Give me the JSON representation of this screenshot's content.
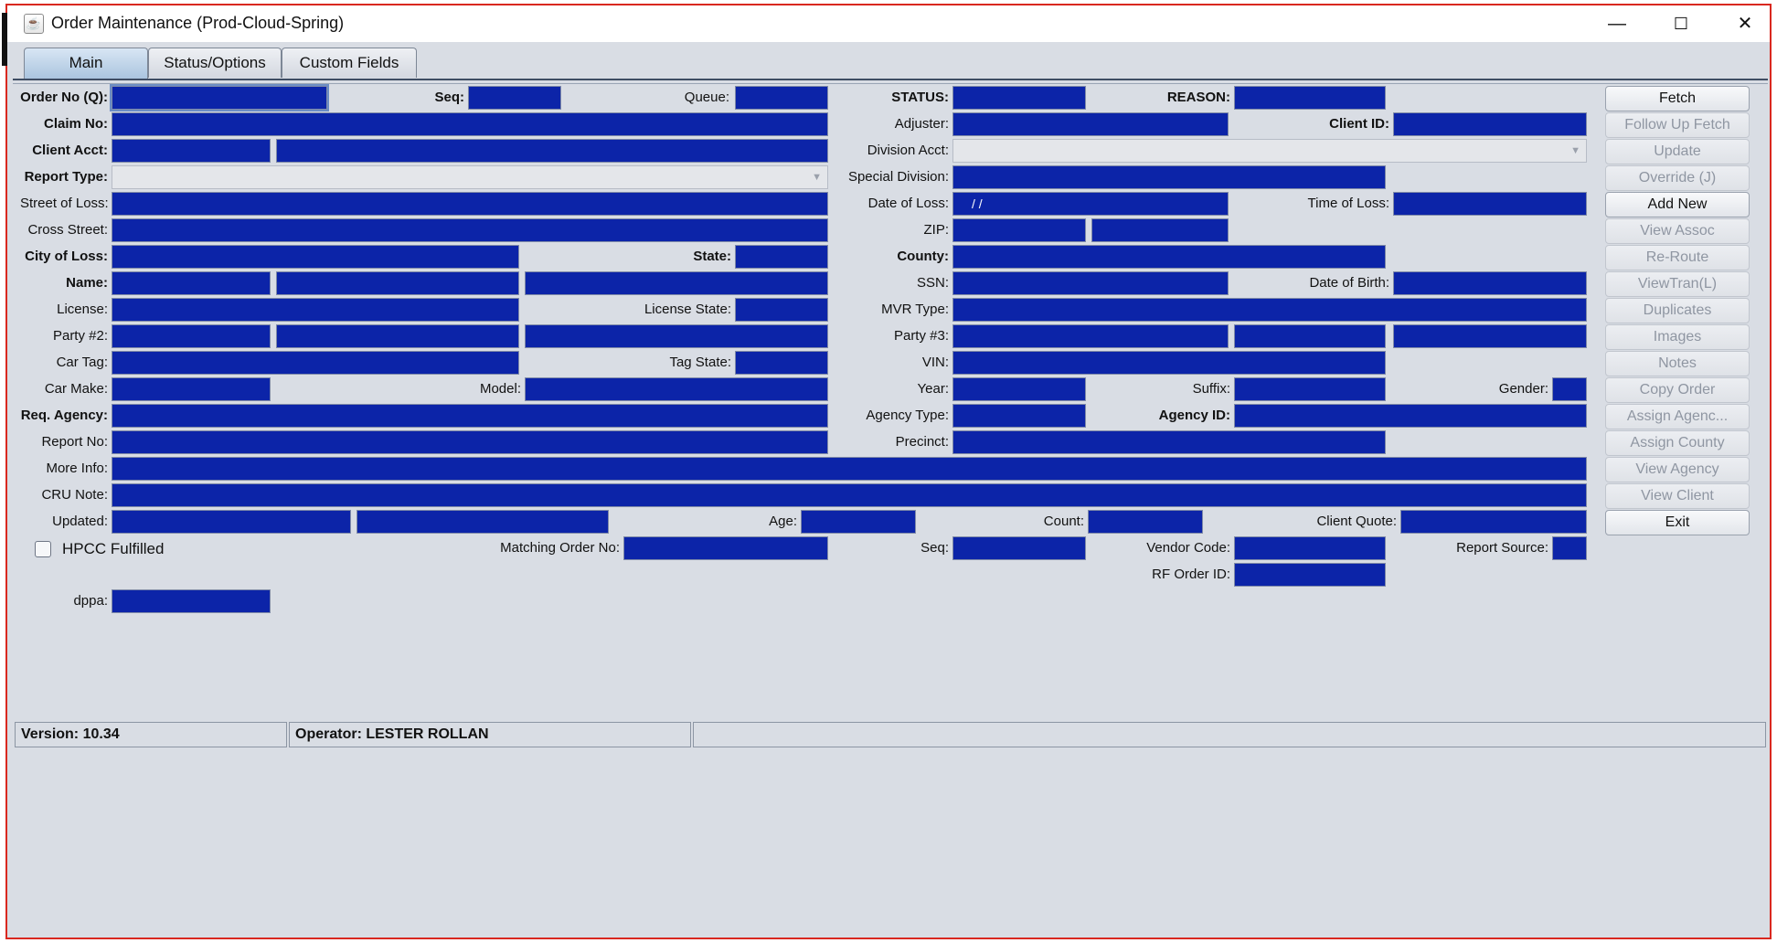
{
  "window": {
    "title": "Order Maintenance (Prod-Cloud-Spring)",
    "controls": {
      "minimize": "—",
      "maximize": "☐",
      "close": "✕"
    }
  },
  "tabs": [
    "Main",
    "Status/Options",
    "Custom Fields"
  ],
  "labels": {
    "order_no": "Order No (Q):",
    "seq": "Seq:",
    "queue": "Queue:",
    "status": "STATUS:",
    "reason": "REASON:",
    "claim_no": "Claim No:",
    "adjuster": "Adjuster:",
    "client_id": "Client ID:",
    "client_acct": "Client Acct:",
    "division_acct": "Division Acct:",
    "report_type": "Report Type:",
    "special_division": "Special Division:",
    "street_of_loss": "Street of Loss:",
    "date_of_loss": "Date of Loss:",
    "time_of_loss": "Time of Loss:",
    "cross_street": "Cross Street:",
    "zip": "ZIP:",
    "city_of_loss": "City of Loss:",
    "state": "State:",
    "county": "County:",
    "name": "Name:",
    "ssn": "SSN:",
    "date_of_birth": "Date of Birth:",
    "license": "License:",
    "license_state": "License State:",
    "mvr_type": "MVR Type:",
    "party2": "Party #2:",
    "party3": "Party #3:",
    "car_tag": "Car Tag:",
    "tag_state": "Tag State:",
    "vin": "VIN:",
    "car_make": "Car Make:",
    "model": "Model:",
    "year": "Year:",
    "suffix": "Suffix:",
    "gender": "Gender:",
    "req_agency": "Req. Agency:",
    "agency_type": "Agency Type:",
    "agency_id": "Agency ID:",
    "report_no": "Report No:",
    "precinct": "Precinct:",
    "more_info": "More Info:",
    "cru_note": "CRU Note:",
    "updated": "Updated:",
    "age": "Age:",
    "count": "Count:",
    "client_quote": "Client Quote:",
    "matching_order_no": "Matching Order No:",
    "seq2": "Seq:",
    "vendor_code": "Vendor Code:",
    "report_source": "Report Source:",
    "rf_order_id": "RF Order ID:",
    "dppa": "dppa:"
  },
  "values": {
    "date_of_loss": "/   /"
  },
  "checkbox": {
    "label": "HPCC Fulfilled",
    "checked": false
  },
  "buttons": [
    {
      "label": "Fetch",
      "enabled": true
    },
    {
      "label": "Follow Up Fetch",
      "enabled": false
    },
    {
      "label": "Update",
      "enabled": false
    },
    {
      "label": "Override (J)",
      "enabled": false
    },
    {
      "label": "Add New",
      "enabled": true
    },
    {
      "label": "View Assoc",
      "enabled": false
    },
    {
      "label": "Re-Route",
      "enabled": false
    },
    {
      "label": "ViewTran(L)",
      "enabled": false
    },
    {
      "label": "Duplicates",
      "enabled": false
    },
    {
      "label": "Images",
      "enabled": false
    },
    {
      "label": "Notes",
      "enabled": false
    },
    {
      "label": "Copy Order",
      "enabled": false
    },
    {
      "label": "Assign Agenc...",
      "enabled": false
    },
    {
      "label": "Assign County",
      "enabled": false
    },
    {
      "label": "View Agency",
      "enabled": false
    },
    {
      "label": "View Client",
      "enabled": false
    },
    {
      "label": "Exit",
      "enabled": true
    }
  ],
  "statusbar": {
    "version": "Version: 10.34",
    "operator": "Operator: LESTER ROLLAN",
    "extra": ""
  },
  "colors": {
    "field": "#0c24a8",
    "background": "#d9dde4",
    "window_border": "#d9281f"
  }
}
